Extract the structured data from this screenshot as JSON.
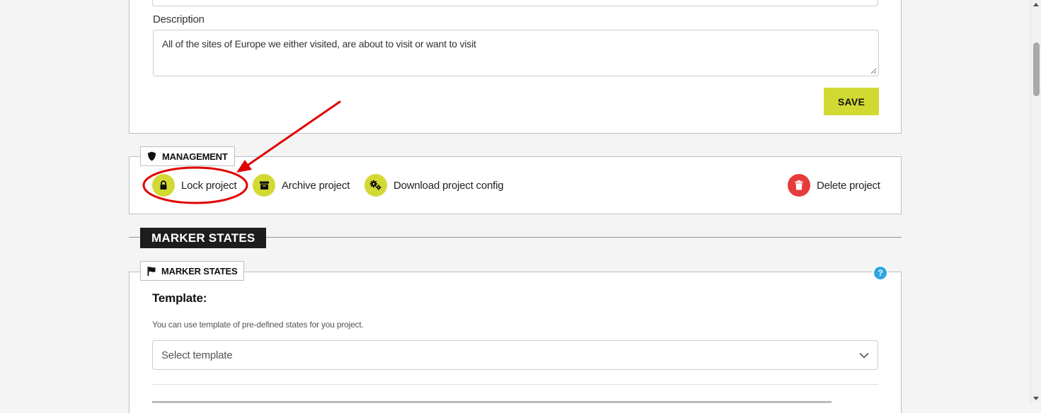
{
  "description": {
    "label": "Description",
    "value": "All of the sites of Europe we either visited, are about to visit or want to visit"
  },
  "save_button": {
    "label": "SAVE"
  },
  "management": {
    "legend": "MANAGEMENT",
    "legend_icon": "shield-icon",
    "actions": [
      {
        "label": "Lock project",
        "icon": "lock-icon"
      },
      {
        "label": "Archive project",
        "icon": "archive-box-icon"
      },
      {
        "label": "Download project config",
        "icon": "gears-icon"
      },
      {
        "label": "Delete project",
        "icon": "trash-icon"
      }
    ]
  },
  "marker_states_section": {
    "title": "MARKER STATES"
  },
  "marker_states": {
    "legend": "MARKER STATES",
    "legend_icon": "flag-icon",
    "help_glyph": "?",
    "template_label": "Template:",
    "template_hint": "You can use template of pre-defined states for you project.",
    "template_select": {
      "placeholder": "Select template"
    }
  },
  "colors": {
    "accent": "#d2d933",
    "danger": "#e63b3b",
    "annotation": "#e00000",
    "help": "#2fa6df",
    "dark_header": "#1d1d1d"
  }
}
